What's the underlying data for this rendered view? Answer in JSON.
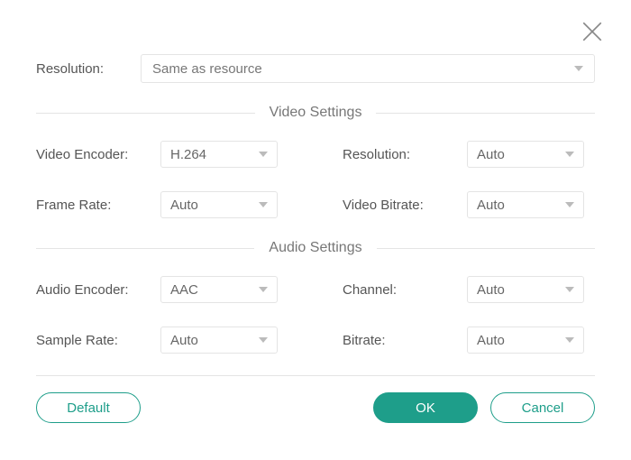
{
  "top": {
    "resolution_label": "Resolution:",
    "resolution_value": "Same as resource"
  },
  "sections": {
    "video_title": "Video Settings",
    "audio_title": "Audio Settings"
  },
  "video": {
    "encoder_label": "Video Encoder:",
    "encoder_value": "H.264",
    "resolution_label": "Resolution:",
    "resolution_value": "Auto",
    "framerate_label": "Frame Rate:",
    "framerate_value": "Auto",
    "bitrate_label": "Video Bitrate:",
    "bitrate_value": "Auto"
  },
  "audio": {
    "encoder_label": "Audio Encoder:",
    "encoder_value": "AAC",
    "channel_label": "Channel:",
    "channel_value": "Auto",
    "samplerate_label": "Sample Rate:",
    "samplerate_value": "Auto",
    "bitrate_label": "Bitrate:",
    "bitrate_value": "Auto"
  },
  "buttons": {
    "default": "Default",
    "ok": "OK",
    "cancel": "Cancel"
  }
}
